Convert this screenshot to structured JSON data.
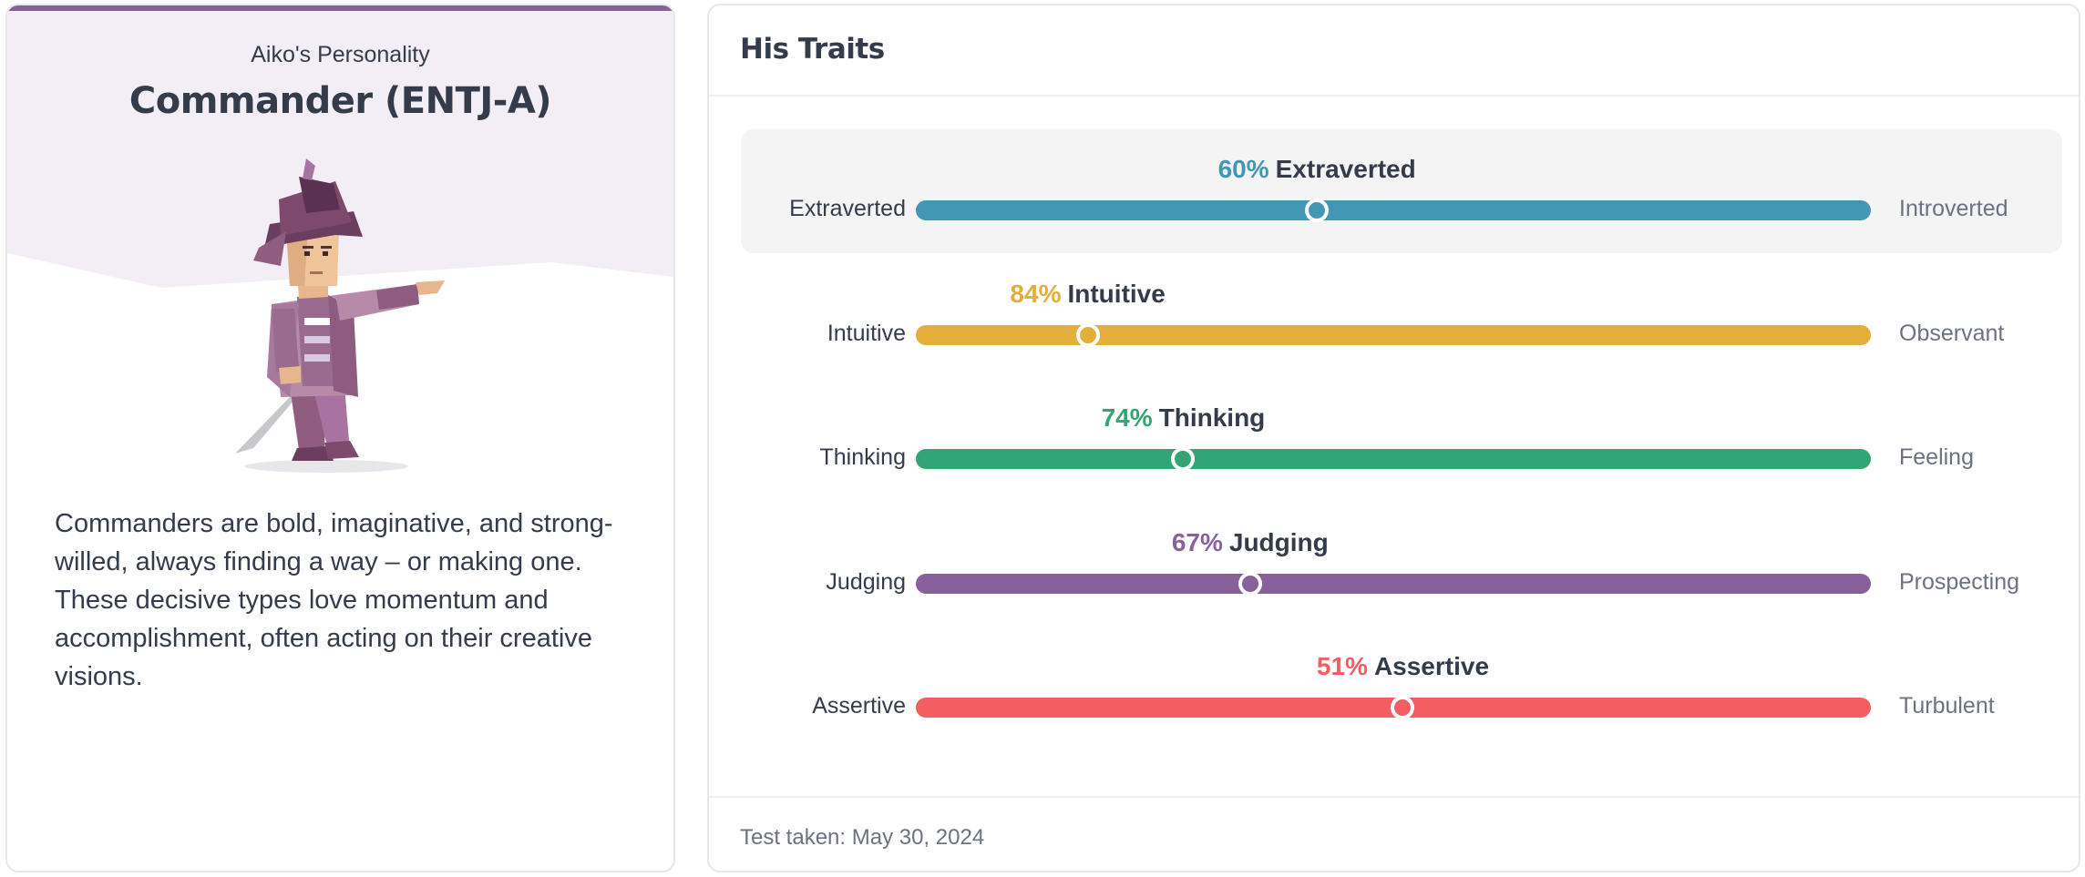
{
  "profile": {
    "subtitle": "Aiko's Personality",
    "type_title": "Commander (ENTJ-A)",
    "description": "Commanders are bold, imaginative, and strong-willed, always finding a way – or making one. These decisive types love momentum and accomplishment, often acting on their creative visions."
  },
  "traits_card": {
    "title": "His Traits",
    "test_date": "Test taken: May 30, 2024"
  },
  "traits": [
    {
      "percent_label": "60%",
      "name": "Extraverted",
      "left": "Extraverted",
      "right": "Introverted",
      "position": 0.42,
      "color": "#4298b4"
    },
    {
      "percent_label": "84%",
      "name": "Intuitive",
      "left": "Intuitive",
      "right": "Observant",
      "position": 0.18,
      "color": "#e4ae3a"
    },
    {
      "percent_label": "74%",
      "name": "Thinking",
      "left": "Thinking",
      "right": "Feeling",
      "position": 0.28,
      "color": "#33a474"
    },
    {
      "percent_label": "67%",
      "name": "Judging",
      "left": "Judging",
      "right": "Prospecting",
      "position": 0.35,
      "color": "#88619a"
    },
    {
      "percent_label": "51%",
      "name": "Assertive",
      "left": "Assertive",
      "right": "Turbulent",
      "position": 0.51,
      "color": "#f25e62"
    }
  ],
  "colors": {
    "accent": "#88619a",
    "hero_background": "#f3eef5",
    "text": "#343c4b",
    "muted": "#6b7280"
  },
  "icons": {
    "illustration": "commander-character-illustration"
  }
}
